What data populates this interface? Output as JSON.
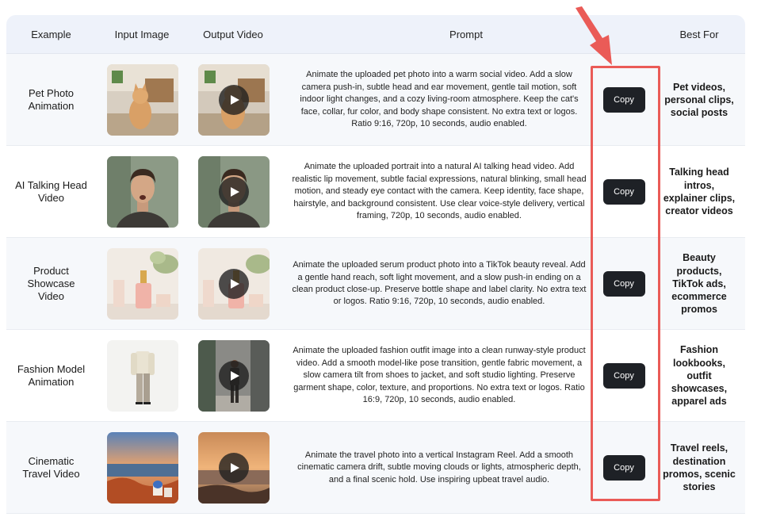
{
  "headers": {
    "example": "Example",
    "input_image": "Input Image",
    "output_video": "Output Video",
    "prompt": "Prompt",
    "best_for": "Best For"
  },
  "rows": [
    {
      "example": "Pet Photo Animation",
      "prompt": "Animate the uploaded pet photo into a warm social video. Add a slow camera push-in, subtle head and ear movement, gentle tail motion, soft indoor light changes, and a cozy living-room atmosphere. Keep the cat's face, collar, fur color, and body shape consistent. No extra text or logos. Ratio 9:16, 720p, 10 seconds, audio enabled.",
      "copy_label": "Copy",
      "best_for": "Pet videos, personal clips, social posts"
    },
    {
      "example": "AI Talking Head Video",
      "prompt": "Animate the uploaded portrait into a natural AI talking head video. Add realistic lip movement, subtle facial expressions, natural blinking, small head motion, and steady eye contact with the camera. Keep identity, face shape, hairstyle, and background consistent. Use clear voice-style delivery, vertical framing, 720p, 10 seconds, audio enabled.",
      "copy_label": "Copy",
      "best_for": "Talking head intros, explainer clips, creator videos"
    },
    {
      "example": "Product Showcase Video",
      "prompt": "Animate the uploaded serum product photo into a TikTok beauty reveal. Add a gentle hand reach, soft light movement, and a slow push-in ending on a clean product close-up. Preserve bottle shape and label clarity. No extra text or logos. Ratio 9:16, 720p, 10 seconds, audio enabled.",
      "copy_label": "Copy",
      "best_for": "Beauty products, TikTok ads, ecommerce promos"
    },
    {
      "example": "Fashion Model Animation",
      "prompt": "Animate the uploaded fashion outfit image into a clean runway-style product video. Add a smooth model-like pose transition, gentle fabric movement, a slow camera tilt from shoes to jacket, and soft studio lighting. Preserve garment shape, color, texture, and proportions. No extra text or logos. Ratio 16:9, 720p, 10 seconds, audio enabled.",
      "copy_label": "Copy",
      "best_for": "Fashion lookbooks, outfit showcases, apparel ads"
    },
    {
      "example": "Cinematic Travel Video",
      "prompt": "Animate the travel photo into a vertical Instagram Reel. Add a smooth cinematic camera drift, subtle moving clouds or lights, atmospheric depth, and a final scenic hold. Use inspiring upbeat travel audio.",
      "copy_label": "Copy",
      "best_for": "Travel reels, destination promos, scenic stories"
    }
  ],
  "colors": {
    "header_bg": "#eef2fa",
    "row_alt_bg": "#f6f8fb",
    "copy_button": "#1e2126",
    "highlight": "#ea5b57"
  },
  "icons": {
    "play": "play-icon",
    "arrow": "red-arrow-annotation"
  }
}
